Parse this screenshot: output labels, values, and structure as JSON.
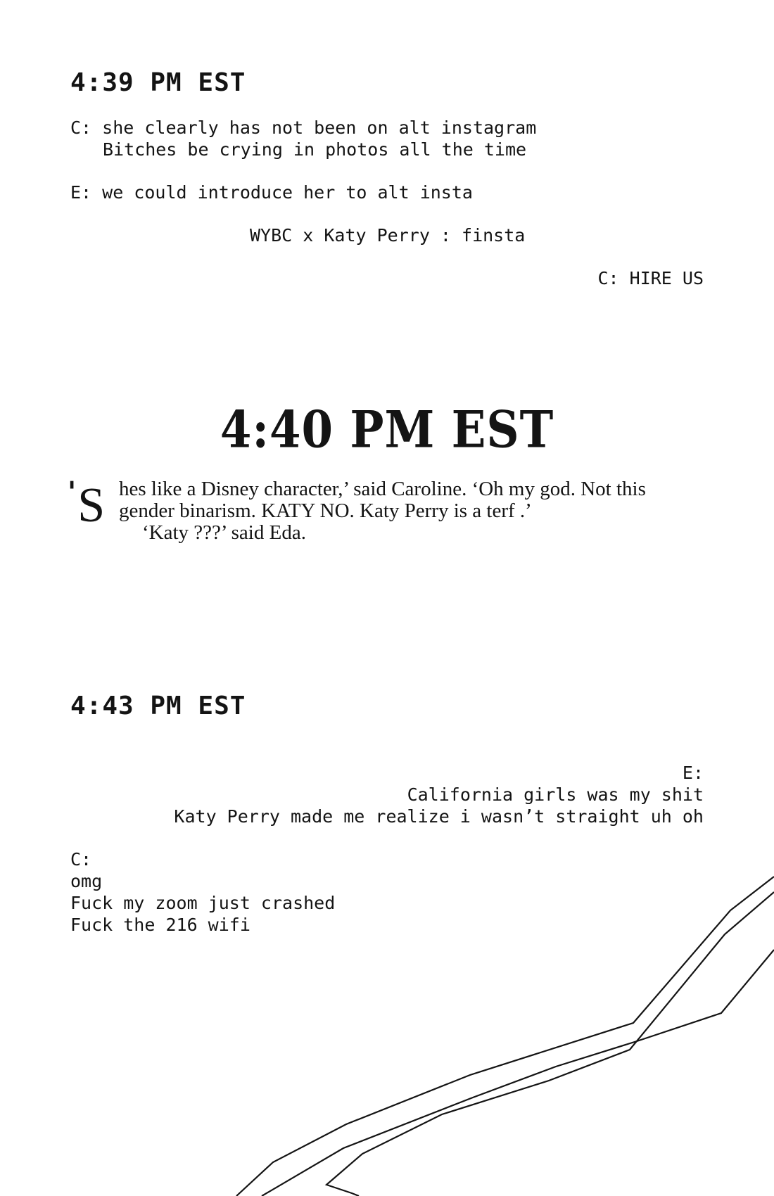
{
  "sections": [
    {
      "timestamp": "4:39 PM EST",
      "lines": [
        "C: she clearly has not been on alt instagram",
        "Bitches be crying in photos all the time",
        "E: we could introduce her to alt insta",
        "WYBC x Katy Perry : finsta",
        "C: HIRE US"
      ]
    },
    {
      "timestamp": "4:40 PM EST",
      "dropcap_quote": "'",
      "dropcap_letter": "S",
      "prose_lines": [
        "hes like a Disney character,’ said Caroline. ‘Oh my god. Not this",
        "gender binarism. KATY NO. Katy Perry is a terf .’",
        "‘Katy ???’ said Eda."
      ]
    },
    {
      "timestamp": "4:43 PM EST",
      "lines": [
        "E:",
        "California girls was my shit",
        "Katy Perry made me realize i wasn’t straight uh oh",
        "C:",
        "omg",
        "Fuck my zoom just crashed",
        "Fuck the 216 wifi"
      ]
    }
  ]
}
